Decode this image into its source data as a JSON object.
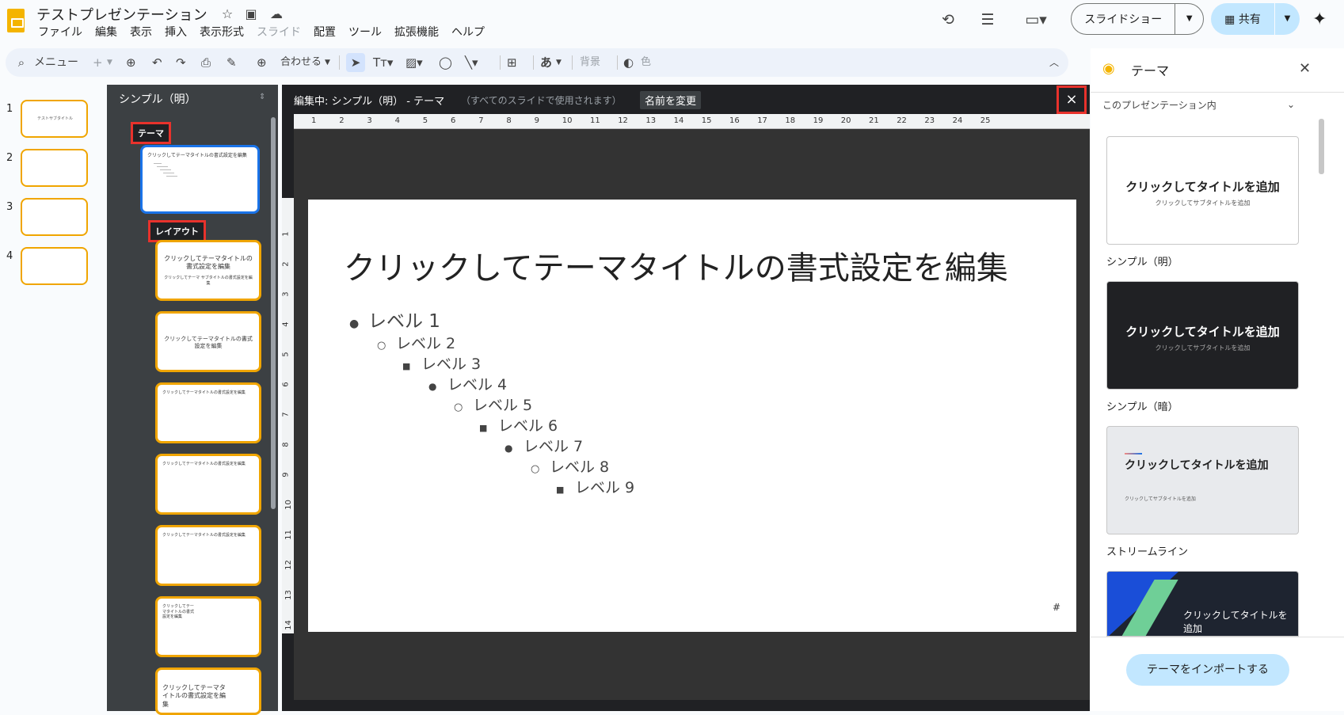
{
  "app": {
    "title": "テストプレゼンテーション"
  },
  "menu": [
    "ファイル",
    "編集",
    "表示",
    "挿入",
    "表示形式",
    "スライド",
    "配置",
    "ツール",
    "拡張機能",
    "ヘルプ"
  ],
  "header": {
    "slideshow_label": "スライドショー",
    "share_label": "共有"
  },
  "toolbar": {
    "menu_search": "メニュー",
    "zoom_label": "合わせる",
    "background": "背景",
    "color": "色",
    "font_char": "あ"
  },
  "filmstrip": [
    {
      "num": "1",
      "text": "テストサブタイトル"
    },
    {
      "num": "2",
      "text": ""
    },
    {
      "num": "3",
      "text": ""
    },
    {
      "num": "4",
      "text": ""
    }
  ],
  "master": {
    "panel_title": "シンプル（明）",
    "theme_tag": "テーマ",
    "layout_tag": "レイアウト",
    "theme_thumb": "クリックしてテーマタイトルの書式設定を編集",
    "layouts": [
      {
        "title": "クリックしてテーマタイトルの書式設定を編集",
        "sub": "クリックしてテーマ サブタイトルの書式設定を編集"
      },
      {
        "title": "クリックしてテーマタイトルの書式設定を編集"
      },
      {
        "title": "クリックしてテーマタイトルの書式設定を編集"
      },
      {
        "title": "クリックしてテーマタイトルの書式設定を編集"
      },
      {
        "title": "クリックしてテーマタイトルの書式設定を編集"
      },
      {
        "title": "クリックしてテーマタイトルの書式設定を編集"
      },
      {
        "title": "クリックしてテーマタイトルの書式設定を編集"
      }
    ]
  },
  "editor": {
    "editing_label": "編集中: シンプル（明） - テーマ",
    "editing_sub": "（すべてのスライドで使用されます）",
    "rename": "名前を変更",
    "close": "×"
  },
  "ruler_h": [
    "1",
    "2",
    "3",
    "4",
    "5",
    "6",
    "7",
    "8",
    "9",
    "10",
    "11",
    "12",
    "13",
    "14",
    "15",
    "16",
    "17",
    "18",
    "19",
    "20",
    "21",
    "22",
    "23",
    "24",
    "25"
  ],
  "ruler_v": [
    "1",
    "2",
    "3",
    "4",
    "5",
    "6",
    "7",
    "8",
    "9",
    "10",
    "11",
    "12",
    "13",
    "14"
  ],
  "slide": {
    "title": "クリックしてテーマタイトルの書式設定を編集",
    "levels": [
      {
        "bullet": "●",
        "text": "レベル 1"
      },
      {
        "bullet": "○",
        "text": "レベル 2"
      },
      {
        "bullet": "■",
        "text": "レベル 3"
      },
      {
        "bullet": "●",
        "text": "レベル 4"
      },
      {
        "bullet": "○",
        "text": "レベル 5"
      },
      {
        "bullet": "■",
        "text": "レベル 6"
      },
      {
        "bullet": "●",
        "text": "レベル 7"
      },
      {
        "bullet": "○",
        "text": "レベル 8"
      },
      {
        "bullet": "■",
        "text": "レベル 9"
      }
    ],
    "number": "#"
  },
  "theme_panel": {
    "title": "テーマ",
    "filter": "このプレゼンテーション内",
    "themes": [
      {
        "name": "シンプル（明）",
        "title": "クリックしてタイトルを追加",
        "sub": "クリックしてサブタイトルを追加"
      },
      {
        "name": "シンプル（暗）",
        "title": "クリックしてタイトルを追加",
        "sub": "クリックしてサブタイトルを追加"
      },
      {
        "name": "ストリームライン",
        "title": "クリックしてタイトルを追加",
        "sub": "クリックしてサブタイトルを追加"
      },
      {
        "name": "",
        "title": "クリックしてタイトルを追加",
        "sub": ""
      }
    ],
    "import_label": "テーマをインポートする"
  },
  "colors": {
    "accent_blue": "#1a73e8",
    "highlight_red": "#e8322c",
    "layout_border": "#f0a500",
    "share_bg": "#c2e7ff"
  }
}
